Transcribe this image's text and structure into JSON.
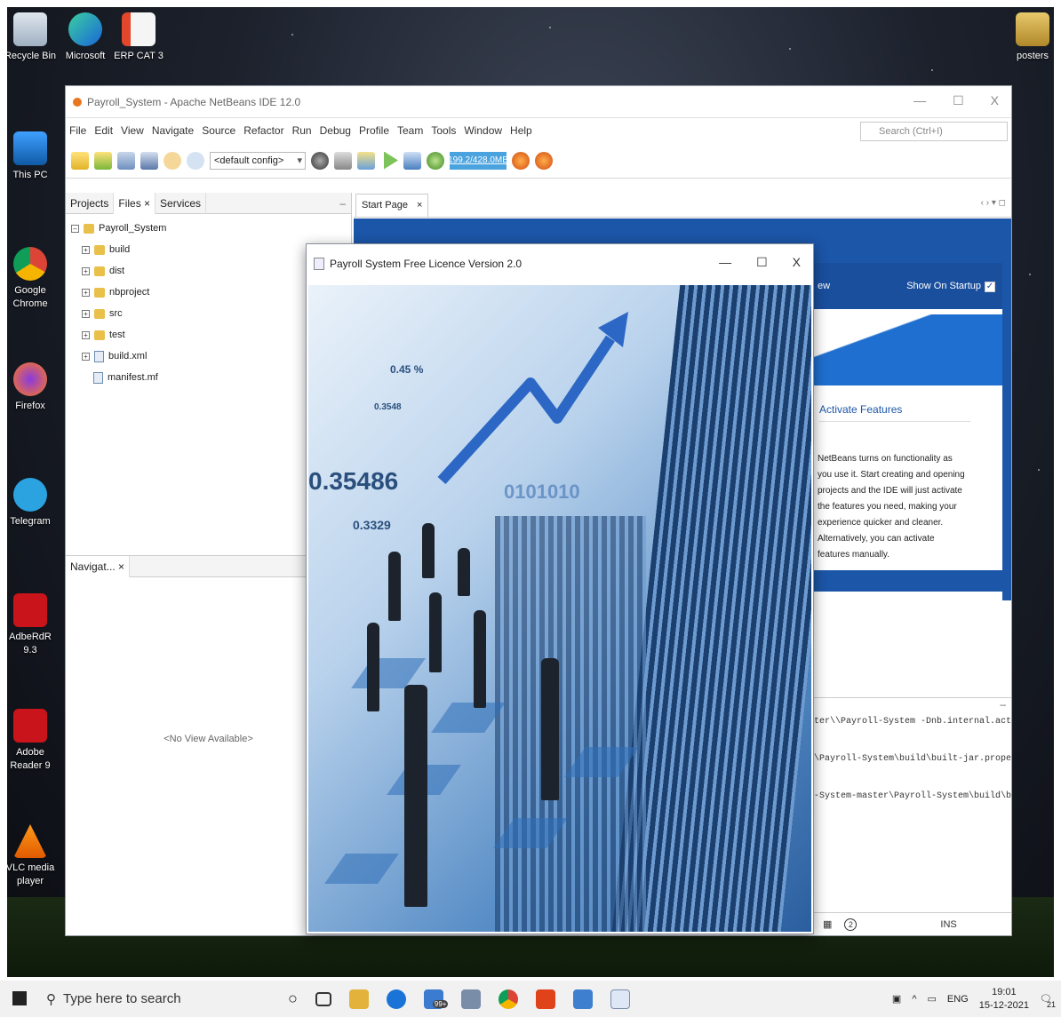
{
  "desktop": {
    "icons_left": [
      {
        "label": "Recycle Bin"
      },
      {
        "label": "This PC"
      },
      {
        "label": "Google Chrome"
      },
      {
        "label": "Firefox"
      },
      {
        "label": "Telegram"
      },
      {
        "label": "AdbeRdR 9.3"
      },
      {
        "label": "Adobe Reader 9"
      },
      {
        "label": "VLC media player"
      }
    ],
    "icons_top": [
      {
        "label": "Microsoft"
      },
      {
        "label": "ERP CAT 3"
      }
    ],
    "icon_right": {
      "label": "posters"
    }
  },
  "ide": {
    "title": "Payroll_System - Apache NetBeans IDE 12.0",
    "controls": [
      "—",
      "☐",
      "X"
    ],
    "menu": [
      "File",
      "Edit",
      "View",
      "Navigate",
      "Source",
      "Refactor",
      "Run",
      "Debug",
      "Profile",
      "Team",
      "Tools",
      "Window",
      "Help"
    ],
    "search_placeholder": "Search (Ctrl+I)",
    "config": "<default config>",
    "memory": "199.2/428.0MB",
    "projects_tabs": [
      "Projects",
      "Files ×",
      "Services"
    ],
    "tree_root": "Payroll_System",
    "tree_items": [
      "build",
      "dist",
      "nbproject",
      "src",
      "test",
      "build.xml",
      "manifest.mf"
    ],
    "navigator_tab": "Navigat... ×",
    "no_view": "<No View Available>",
    "editor_tab": "Start Page",
    "editor_tab_close": "×",
    "editor_nav": "‹ › ▾ ◻",
    "start_page": {
      "header_left": "ew",
      "show_on_startup": "Show On Startup",
      "activate_title": "Activate Features",
      "activate_text": "NetBeans turns on functionality as you use it. Start creating and opening projects and the IDE will just activate the features you need, making your experience quicker and cleaner. Alternatively, you can activate features manually."
    },
    "output_lines": [
      "ter\\\\Payroll-System -Dnb.internal.action.n",
      "\\Payroll-System\\build\\built-jar.properties",
      "-System-master\\Payroll-System\\build\\built-"
    ],
    "status": {
      "notif": "2",
      "mode": "INS"
    }
  },
  "splash": {
    "title": "Payroll System  Free Licence Version 2.0",
    "controls": [
      "—",
      "☐",
      "X"
    ],
    "figures": [
      "0.35486",
      "0.45 %",
      "0.3548",
      "0.3329",
      "0101010"
    ]
  },
  "taskbar": {
    "search_placeholder": "Type here to search",
    "badge": "99+",
    "lang": "ENG",
    "time": "19:01",
    "date": "15-12-2021",
    "notif_count": "21"
  }
}
